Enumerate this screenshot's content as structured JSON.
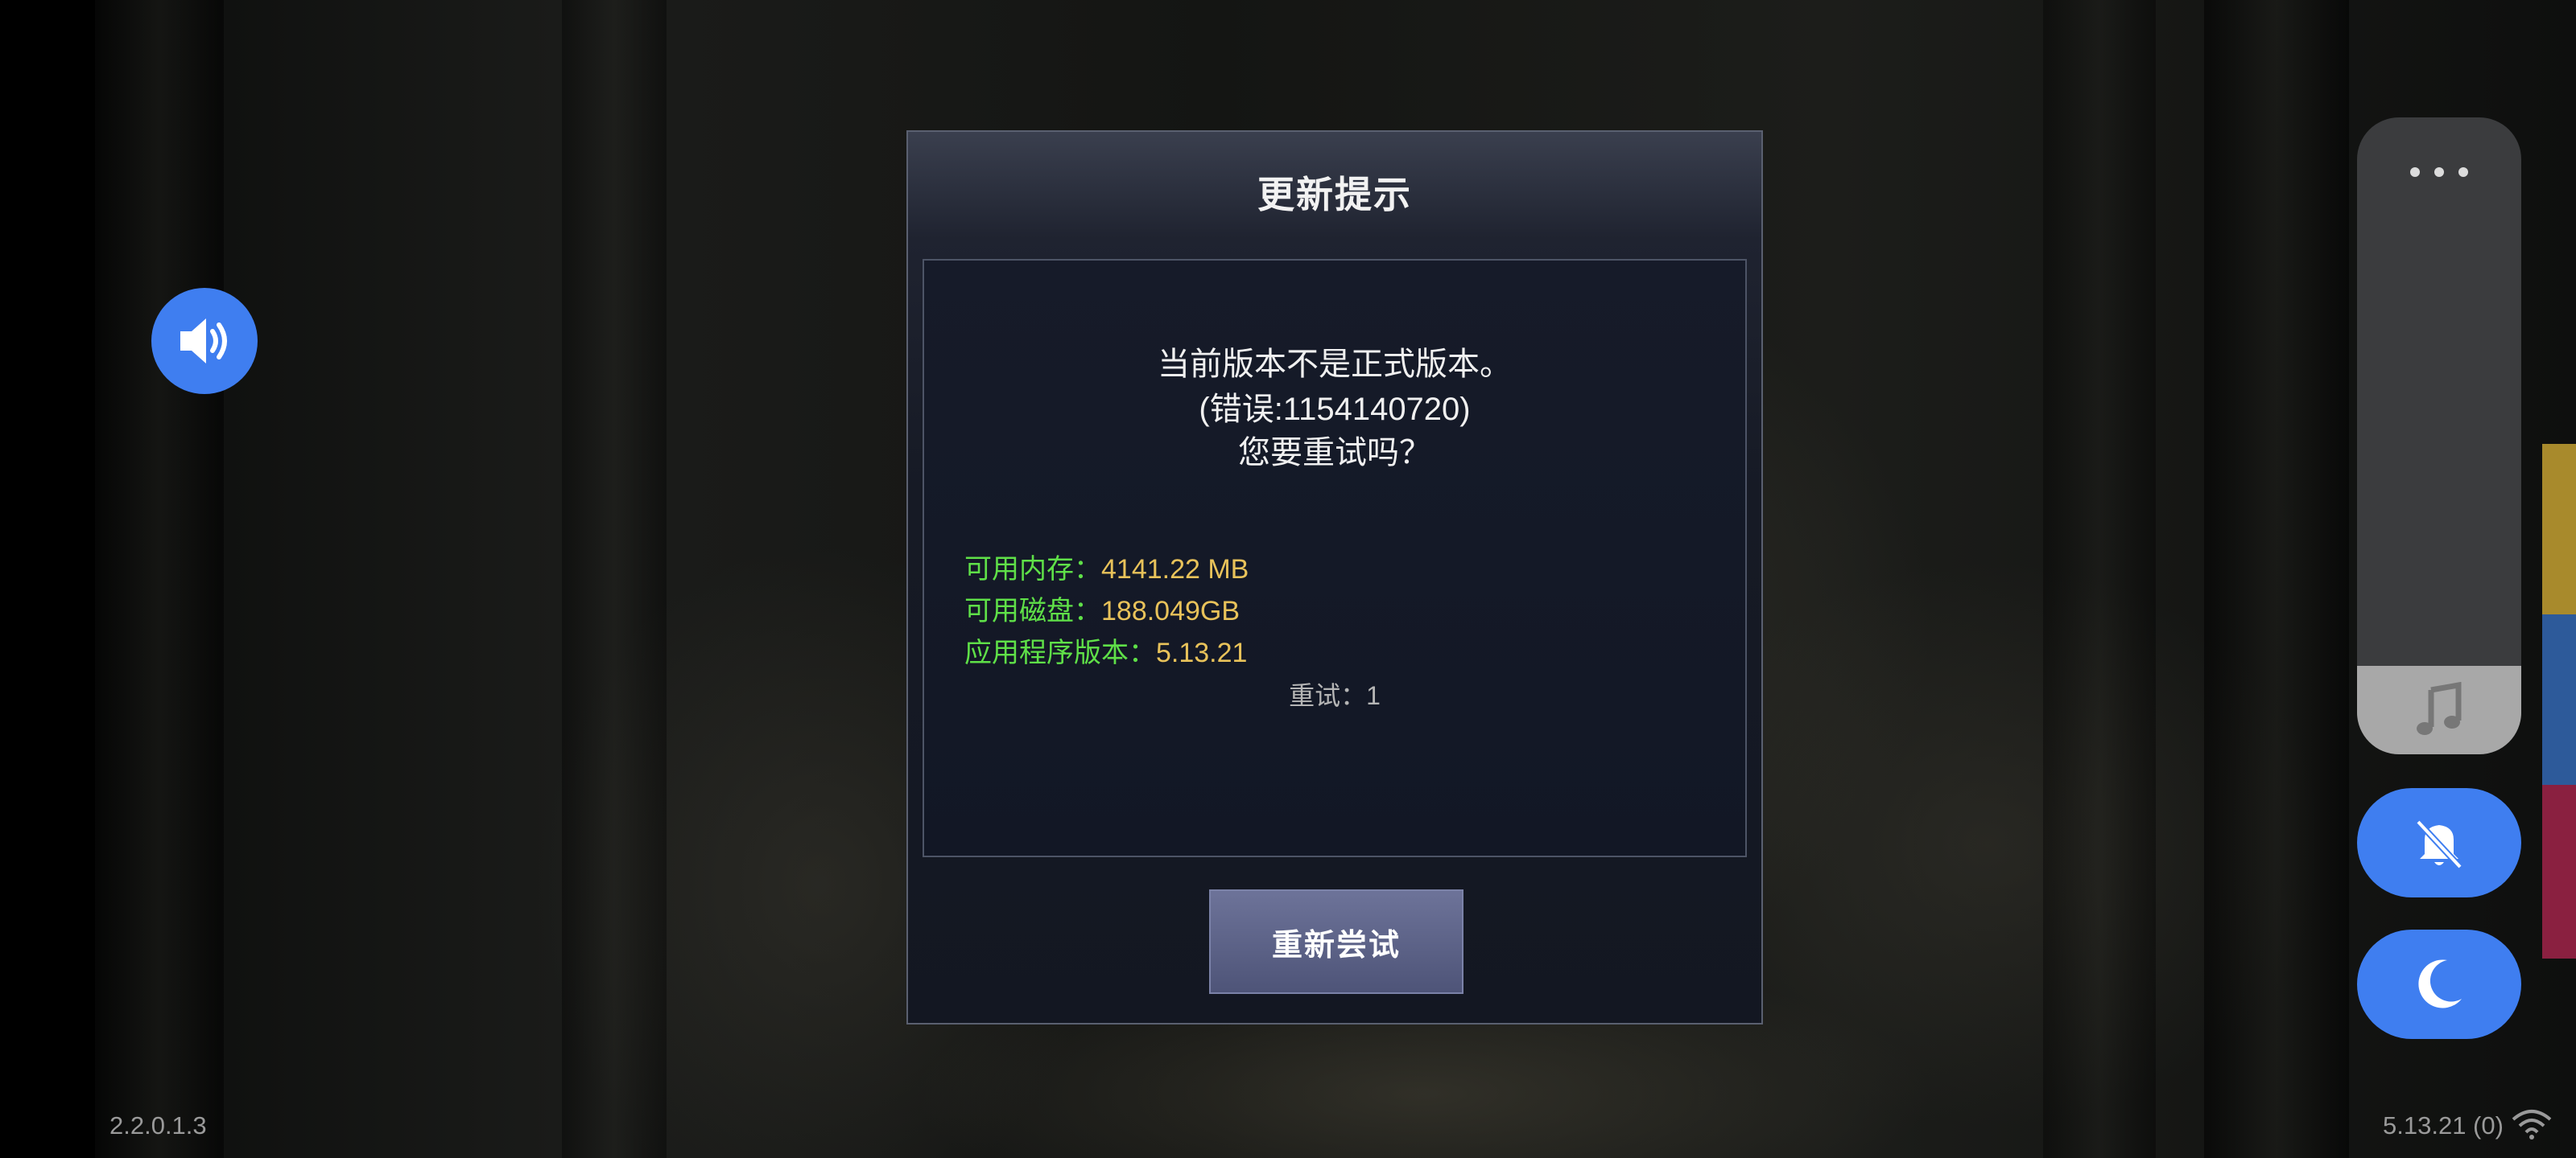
{
  "background": {
    "left_version": "2.2.0.1.3",
    "right_version": "5.13.21 (0)"
  },
  "dialog": {
    "title": "更新提示",
    "message_line1": "当前版本不是正式版本。",
    "message_line2": "(错误:1154140720)",
    "message_line3": "您要重试吗？",
    "info": [
      {
        "label": "可用内存：",
        "value": "4141.22 MB"
      },
      {
        "label": "可用磁盘：",
        "value": "188.049GB"
      },
      {
        "label": "应用程序版本：",
        "value": "5.13.21"
      }
    ],
    "retry_count": "重试：1",
    "retry_button_label": "重新尝试"
  },
  "side_panel": {
    "icons": [
      "more-icon",
      "music-note-icon",
      "mute-bell-icon",
      "moon-icon",
      "volume-icon",
      "wifi-icon"
    ]
  },
  "colors": {
    "accent_blue": "#3f7ef0",
    "label_green": "#5fe048",
    "value_gold": "#e8c25a",
    "strip": [
      "#a88a2c",
      "#2d5a9a",
      "#8a2040"
    ]
  }
}
